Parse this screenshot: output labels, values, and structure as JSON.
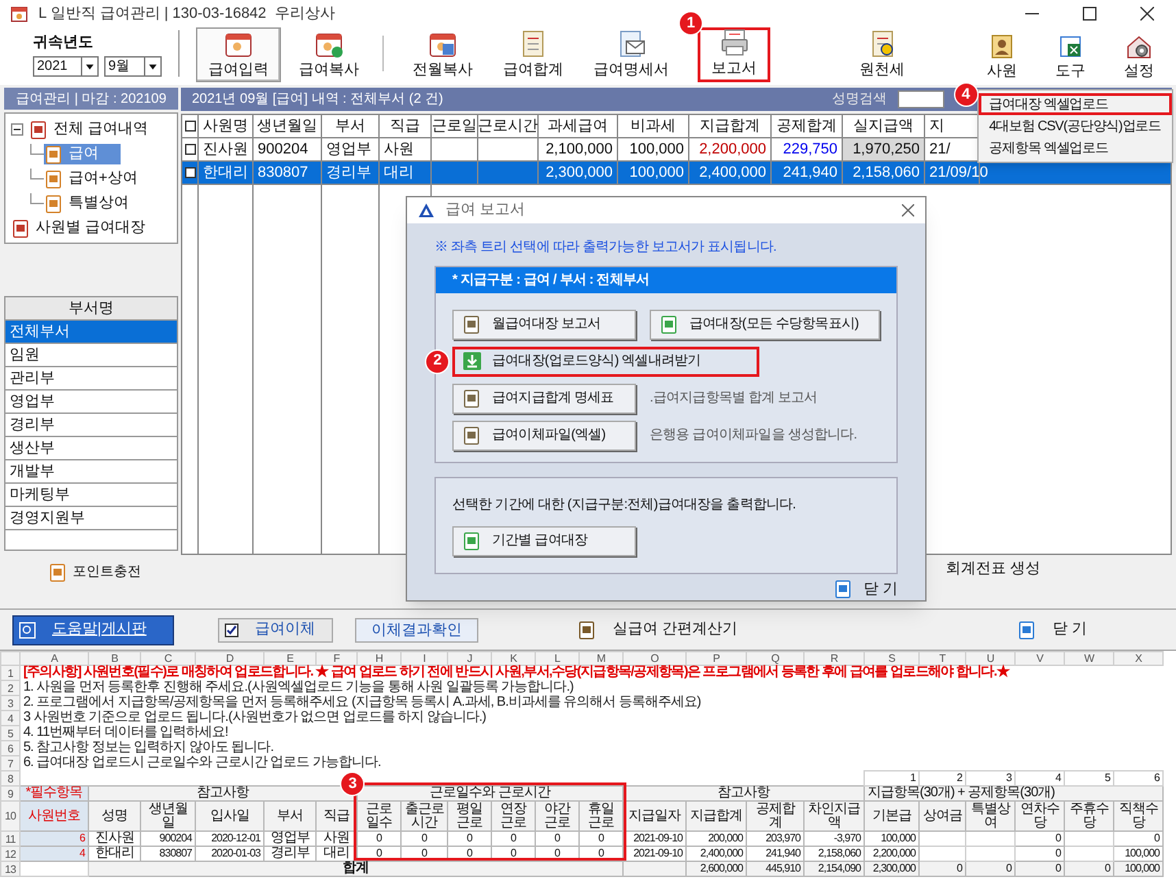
{
  "window": {
    "title": "L 일반직 급여관리 | 130-03-16842  우리상사"
  },
  "toolbar": {
    "year_label": "귀속년도",
    "year": "2021",
    "month": "9월",
    "buttons": [
      {
        "label": "급여입력",
        "selected": true
      },
      {
        "label": "급여복사",
        "selected": false
      },
      {
        "label": "전월복사",
        "selected": false
      },
      {
        "label": "급여합계",
        "selected": false
      },
      {
        "label": "급여명세서",
        "selected": false
      },
      {
        "label": "보고서",
        "selected": false,
        "badge": "1"
      },
      {
        "label": "원천세",
        "selected": false
      }
    ],
    "right_buttons": [
      "사원",
      "도구",
      "설정"
    ]
  },
  "left_panel": {
    "header": "급여관리 | 마감 : 202109",
    "tree": [
      {
        "label": "전체 급여내역",
        "selected": false,
        "expanded": true,
        "children": [
          {
            "label": "급여",
            "selected": true
          },
          {
            "label": "급여+상여",
            "selected": false
          },
          {
            "label": "특별상여",
            "selected": false
          }
        ]
      },
      {
        "label": "사원별 급여대장",
        "selected": false
      }
    ],
    "department_header": "부서명",
    "departments": [
      {
        "label": "전체부서",
        "selected": true
      },
      {
        "label": "임원",
        "selected": false
      },
      {
        "label": "관리부",
        "selected": false
      },
      {
        "label": "영업부",
        "selected": false
      },
      {
        "label": "경리부",
        "selected": false
      },
      {
        "label": "생산부",
        "selected": false
      },
      {
        "label": "개발부",
        "selected": false
      },
      {
        "label": "마케팅부",
        "selected": false
      },
      {
        "label": "경영지원부",
        "selected": false
      }
    ],
    "point_button": "포인트충전"
  },
  "payroll": {
    "title": "2021년 09월 [급여] 내역 : 전체부서 (2 건)",
    "search_label": "성명검색",
    "all_checked": false,
    "columns": [
      "사원명",
      "생년월일",
      "부서",
      "직급",
      "근로일",
      "근로시간",
      "과세급여",
      "비과세",
      "지급합계",
      "공제합계",
      "실지급액",
      "지"
    ],
    "rows": [
      {
        "checked": false,
        "selected": false,
        "cells": [
          "진사원",
          "900204",
          "영업부",
          "사원",
          "",
          "",
          "2,100,000",
          "100,000",
          "2,200,000",
          "229,750",
          "1,970,250",
          "21/"
        ]
      },
      {
        "checked": false,
        "selected": true,
        "cells": [
          "한대리",
          "830807",
          "경리부",
          "대리",
          "",
          "",
          "2,300,000",
          "100,000",
          "2,400,000",
          "241,940",
          "2,158,060",
          "21/09/10"
        ]
      }
    ],
    "accounting_button": "회계전표 생성"
  },
  "menu": {
    "items": [
      {
        "label": "급여대장 엑셀업로드",
        "highlighted": true,
        "badge": "4"
      },
      {
        "label": "4대보험 CSV(공단양식)업로드",
        "highlighted": false
      },
      {
        "label": "공제항목 엑셀업로드",
        "highlighted": false
      }
    ]
  },
  "dialog": {
    "title": "급여 보고서",
    "notice": "※ 좌측 트리 선택에 따라 출력가능한 보고서가 표시됩니다.",
    "group_title": "* 지급구분 : 급여 / 부서 : 전체부서",
    "buttons": [
      {
        "label": "월급여대장 보고서",
        "kind": "raised"
      },
      {
        "label": "급여대장(모든 수당항목표시)",
        "kind": "raised"
      },
      {
        "label": "급여대장(업로드양식) 엑셀내려받기",
        "kind": "flat",
        "badge": "2"
      },
      {
        "label": "급여지급합계 명세표",
        "kind": "raised",
        "note": ".급여지급항목별 합계 보고서"
      },
      {
        "label": "급여이체파일(엑셀)",
        "kind": "raised",
        "note": "은행용 급여이체파일을 생성합니다."
      }
    ],
    "period_text": "선택한 기간에 대한 (지급구분:전체)급여대장을 출력합니다.",
    "period_button": "기간별 급여대장",
    "close": "닫 기"
  },
  "bottom_bar": {
    "help_button": "도움말|게시판",
    "transfer": {
      "label": "급여이체",
      "checked": true
    },
    "transfer_result_button": "이체결과확인",
    "calculator": "실급여 간편계산기",
    "close": "닫 기"
  },
  "spreadsheet": {
    "badge": "3",
    "column_letters": [
      "A",
      "B",
      "C",
      "D",
      "E",
      "F",
      "H",
      "I",
      "J",
      "K",
      "L",
      "M",
      "O",
      "P",
      "Q",
      "R",
      "S",
      "T",
      "U",
      "V",
      "W",
      "X"
    ],
    "row_numbers": [
      "1",
      "2",
      "3",
      "4",
      "5",
      "6",
      "7",
      "8",
      "9",
      "10",
      "11",
      "12",
      "13"
    ],
    "notice": "[주의사항] 사원번호(필수)로 매칭하여 업로드합니다.  ★ 급여 업로드 하기 전에 반드시 사원,부서,수당(지급항목/공제항목)은 프로그램에서 등록한 후에 급여를 업로드해야 합니다.★",
    "instructions": [
      "1. 사원을 먼저 등록한후 진행해 주세요.(사원엑셀업로드 기능을 통해 사원 일괄등록 가능합니다.)",
      "2. 프로그램에서 지급항목/공제항목을 먼저 등록해주세요 (지급항목 등록시 A.과세, B.비과세를 유의해서 등록해주세요)",
      "3 사원번호 기준으로 업로드 됩니다.(사원번호가 없으면 업로드를 하지 않습니다.)",
      "4. 11번째부터 데이터를 입력하세요!",
      "5. 참고사항 정보는 입력하지 않아도 됩니다.",
      "6. 급여대장 업로드시 근로일수와 근로시간 업로드 가능합니다."
    ],
    "item_numbers": [
      "1",
      "2",
      "3",
      "4",
      "5",
      "6"
    ],
    "group_headers": {
      "required": "*필수항목",
      "reference": "참고사항",
      "work": "근로일수와 근로시간",
      "reference_2": "참고사항",
      "items": "지급항목(30개)  + 공제항목(30개)"
    },
    "required_header": "사원번호",
    "headers": [
      "성명",
      "생년월일",
      "입사일",
      "부서",
      "직급",
      "근로일수",
      "출근로시간",
      "평일근로",
      "연장근로",
      "야간근로",
      "휴일근로",
      "지급일자",
      "지급합계",
      "공제합계",
      "차인지급액",
      "기본급",
      "상여금",
      "특별상여",
      "연차수당",
      "주휴수당",
      "직책수당"
    ],
    "rows": [
      {
        "employee_no": "6",
        "name": "진사원",
        "birth": "900204",
        "hire_date": "2020-12-01",
        "department": "영업부",
        "position": "사원",
        "work": [
          "0",
          "0",
          "0",
          "0",
          "0",
          "0"
        ],
        "pay_date": "2021-09-10",
        "pay_total": "200,000",
        "deduction_total": "203,970",
        "net_pay": "-3,970",
        "allowances": {
          "base": "100,000",
          "annual_leave": "0",
          "position_allowance": "0"
        }
      },
      {
        "employee_no": "4",
        "name": "한대리",
        "birth": "830807",
        "hire_date": "2020-01-03",
        "department": "경리부",
        "position": "대리",
        "work": [
          "0",
          "0",
          "0",
          "0",
          "0",
          "0"
        ],
        "pay_date": "2021-09-10",
        "pay_total": "2,400,000",
        "deduction_total": "241,940",
        "net_pay": "2,158,060",
        "allowances": {
          "base": "2,200,000",
          "annual_leave": "0",
          "position_allowance": "100,000"
        }
      }
    ],
    "totals": {
      "label": "합계",
      "pay_total": "2,600,000",
      "deduction_total": "445,910",
      "net_pay": "2,154,090",
      "allowances": {
        "base": "2,300,000",
        "bonus": "0",
        "special_bonus": "0",
        "annual_leave": "0",
        "weekly_holiday": "0",
        "position_allowance": "100,000"
      }
    }
  }
}
